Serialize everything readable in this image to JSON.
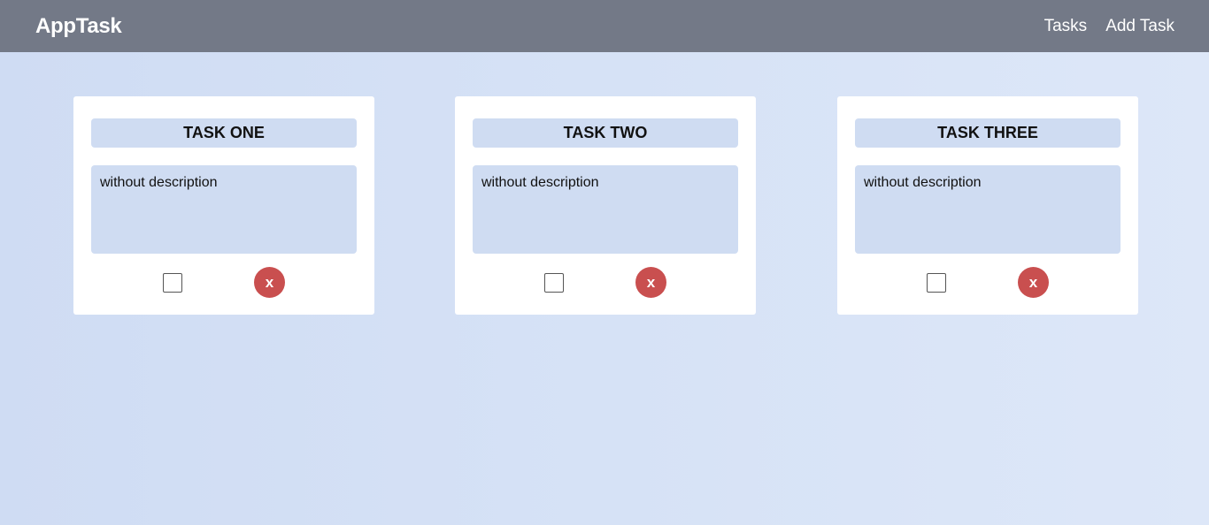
{
  "navbar": {
    "brand": "AppTask",
    "links": [
      {
        "label": "Tasks"
      },
      {
        "label": "Add Task"
      }
    ]
  },
  "tasks": [
    {
      "title": "TASK ONE",
      "description": "without description",
      "completed": false,
      "delete_label": "x"
    },
    {
      "title": "TASK TWO",
      "description": "without description",
      "completed": false,
      "delete_label": "x"
    },
    {
      "title": "TASK THREE",
      "description": "without description",
      "completed": false,
      "delete_label": "x"
    }
  ],
  "colors": {
    "navbar": "#737987",
    "card_field": "#cfdcf2",
    "delete_button": "#c94f4f"
  }
}
